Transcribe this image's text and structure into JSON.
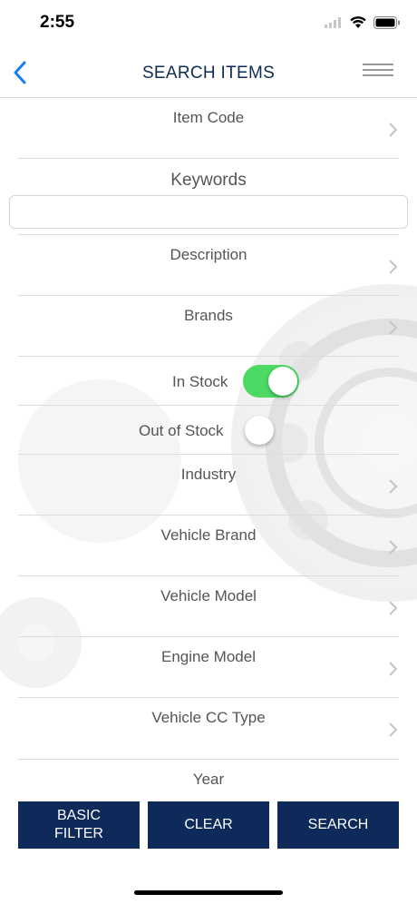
{
  "status_bar": {
    "time": "2:55"
  },
  "nav": {
    "title": "SEARCH ITEMS"
  },
  "form": {
    "item_code_label": "Item Code",
    "keywords_label": "Keywords",
    "keywords_value": "",
    "keywords_placeholder": "",
    "description_label": "Description",
    "brands_label": "Brands",
    "in_stock_label": "In Stock",
    "in_stock_on": true,
    "out_of_stock_label": "Out of Stock",
    "out_of_stock_on": false,
    "industry_label": "Industry",
    "vehicle_brand_label": "Vehicle Brand",
    "vehicle_model_label": "Vehicle Model",
    "engine_model_label": "Engine Model",
    "vehicle_cc_type_label": "Vehicle CC Type",
    "year_label": "Year"
  },
  "buttons": {
    "basic_filter_label": "BASIC\nFILTER",
    "clear_label": "CLEAR",
    "search_label": "SEARCH"
  },
  "colors": {
    "accent_blue": "#0f2b54",
    "button_bg": "#0d2a5a",
    "toggle_on": "#4cd964",
    "back_arrow": "#1a7cf5"
  },
  "icons": {
    "back": "chevron-left-icon",
    "menu": "hamburger-menu-icon",
    "row_disclosure": "chevron-right-icon"
  }
}
